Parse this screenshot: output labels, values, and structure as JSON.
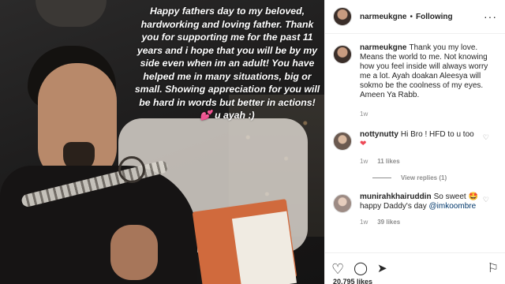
{
  "post": {
    "story_text": "Happy fathers day to my beloved, hardworking and loving father. Thank you for supporting me for the past 11 years and i hope  that you will be by my side even when im an adult! You have helped me in many situations, big or small. Showing appreciation for you will be hard in words but better in actions! 💕 u ayah :)"
  },
  "header": {
    "username": "narmeukgne",
    "separator": "•",
    "follow_label": "Following",
    "more_icon": "···"
  },
  "caption": {
    "username": "narmeukgne",
    "text": "Thank you my love. Means the world to me. Not knowing how you feel inside will always worry me a lot. Ayah doakan Aleesya will sokmo be the coolness of my eyes. Ameen Ya Rabb.",
    "time": "1w"
  },
  "comments": [
    {
      "username": "nottynutty",
      "text": "Hi Bro ! HFD to u too",
      "emoji": "❤",
      "time": "1w",
      "likes": "11 likes",
      "view_replies": "View replies (1)"
    },
    {
      "username": "munirahkhairuddin",
      "text": "So sweet 🤩 happy Daddy's day",
      "mention": "@imkoombre",
      "time": "1w",
      "likes": "39 likes"
    }
  ],
  "footer": {
    "likes_partial": "20,795 likes"
  },
  "icons": {
    "like": "heart-icon",
    "comment": "comment-icon",
    "share": "share-icon",
    "save": "bookmark-icon"
  },
  "colors": {
    "mention": "#00376b",
    "muted": "#8e8e8e",
    "heart": "#ed4956"
  }
}
